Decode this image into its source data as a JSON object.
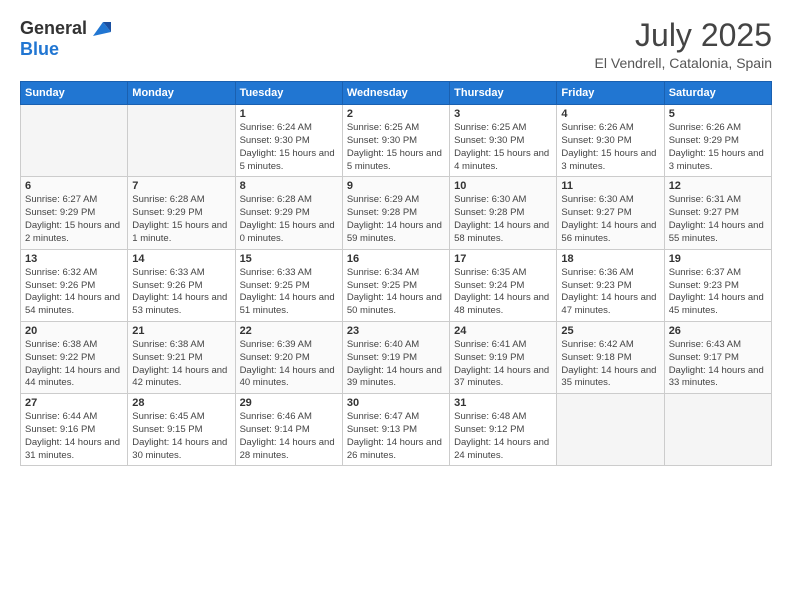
{
  "header": {
    "logo_general": "General",
    "logo_blue": "Blue",
    "month_year": "July 2025",
    "location": "El Vendrell, Catalonia, Spain"
  },
  "weekdays": [
    "Sunday",
    "Monday",
    "Tuesday",
    "Wednesday",
    "Thursday",
    "Friday",
    "Saturday"
  ],
  "weeks": [
    [
      {
        "day": "",
        "info": ""
      },
      {
        "day": "",
        "info": ""
      },
      {
        "day": "1",
        "info": "Sunrise: 6:24 AM\nSunset: 9:30 PM\nDaylight: 15 hours and 5 minutes."
      },
      {
        "day": "2",
        "info": "Sunrise: 6:25 AM\nSunset: 9:30 PM\nDaylight: 15 hours and 5 minutes."
      },
      {
        "day": "3",
        "info": "Sunrise: 6:25 AM\nSunset: 9:30 PM\nDaylight: 15 hours and 4 minutes."
      },
      {
        "day": "4",
        "info": "Sunrise: 6:26 AM\nSunset: 9:30 PM\nDaylight: 15 hours and 3 minutes."
      },
      {
        "day": "5",
        "info": "Sunrise: 6:26 AM\nSunset: 9:29 PM\nDaylight: 15 hours and 3 minutes."
      }
    ],
    [
      {
        "day": "6",
        "info": "Sunrise: 6:27 AM\nSunset: 9:29 PM\nDaylight: 15 hours and 2 minutes."
      },
      {
        "day": "7",
        "info": "Sunrise: 6:28 AM\nSunset: 9:29 PM\nDaylight: 15 hours and 1 minute."
      },
      {
        "day": "8",
        "info": "Sunrise: 6:28 AM\nSunset: 9:29 PM\nDaylight: 15 hours and 0 minutes."
      },
      {
        "day": "9",
        "info": "Sunrise: 6:29 AM\nSunset: 9:28 PM\nDaylight: 14 hours and 59 minutes."
      },
      {
        "day": "10",
        "info": "Sunrise: 6:30 AM\nSunset: 9:28 PM\nDaylight: 14 hours and 58 minutes."
      },
      {
        "day": "11",
        "info": "Sunrise: 6:30 AM\nSunset: 9:27 PM\nDaylight: 14 hours and 56 minutes."
      },
      {
        "day": "12",
        "info": "Sunrise: 6:31 AM\nSunset: 9:27 PM\nDaylight: 14 hours and 55 minutes."
      }
    ],
    [
      {
        "day": "13",
        "info": "Sunrise: 6:32 AM\nSunset: 9:26 PM\nDaylight: 14 hours and 54 minutes."
      },
      {
        "day": "14",
        "info": "Sunrise: 6:33 AM\nSunset: 9:26 PM\nDaylight: 14 hours and 53 minutes."
      },
      {
        "day": "15",
        "info": "Sunrise: 6:33 AM\nSunset: 9:25 PM\nDaylight: 14 hours and 51 minutes."
      },
      {
        "day": "16",
        "info": "Sunrise: 6:34 AM\nSunset: 9:25 PM\nDaylight: 14 hours and 50 minutes."
      },
      {
        "day": "17",
        "info": "Sunrise: 6:35 AM\nSunset: 9:24 PM\nDaylight: 14 hours and 48 minutes."
      },
      {
        "day": "18",
        "info": "Sunrise: 6:36 AM\nSunset: 9:23 PM\nDaylight: 14 hours and 47 minutes."
      },
      {
        "day": "19",
        "info": "Sunrise: 6:37 AM\nSunset: 9:23 PM\nDaylight: 14 hours and 45 minutes."
      }
    ],
    [
      {
        "day": "20",
        "info": "Sunrise: 6:38 AM\nSunset: 9:22 PM\nDaylight: 14 hours and 44 minutes."
      },
      {
        "day": "21",
        "info": "Sunrise: 6:38 AM\nSunset: 9:21 PM\nDaylight: 14 hours and 42 minutes."
      },
      {
        "day": "22",
        "info": "Sunrise: 6:39 AM\nSunset: 9:20 PM\nDaylight: 14 hours and 40 minutes."
      },
      {
        "day": "23",
        "info": "Sunrise: 6:40 AM\nSunset: 9:19 PM\nDaylight: 14 hours and 39 minutes."
      },
      {
        "day": "24",
        "info": "Sunrise: 6:41 AM\nSunset: 9:19 PM\nDaylight: 14 hours and 37 minutes."
      },
      {
        "day": "25",
        "info": "Sunrise: 6:42 AM\nSunset: 9:18 PM\nDaylight: 14 hours and 35 minutes."
      },
      {
        "day": "26",
        "info": "Sunrise: 6:43 AM\nSunset: 9:17 PM\nDaylight: 14 hours and 33 minutes."
      }
    ],
    [
      {
        "day": "27",
        "info": "Sunrise: 6:44 AM\nSunset: 9:16 PM\nDaylight: 14 hours and 31 minutes."
      },
      {
        "day": "28",
        "info": "Sunrise: 6:45 AM\nSunset: 9:15 PM\nDaylight: 14 hours and 30 minutes."
      },
      {
        "day": "29",
        "info": "Sunrise: 6:46 AM\nSunset: 9:14 PM\nDaylight: 14 hours and 28 minutes."
      },
      {
        "day": "30",
        "info": "Sunrise: 6:47 AM\nSunset: 9:13 PM\nDaylight: 14 hours and 26 minutes."
      },
      {
        "day": "31",
        "info": "Sunrise: 6:48 AM\nSunset: 9:12 PM\nDaylight: 14 hours and 24 minutes."
      },
      {
        "day": "",
        "info": ""
      },
      {
        "day": "",
        "info": ""
      }
    ]
  ]
}
